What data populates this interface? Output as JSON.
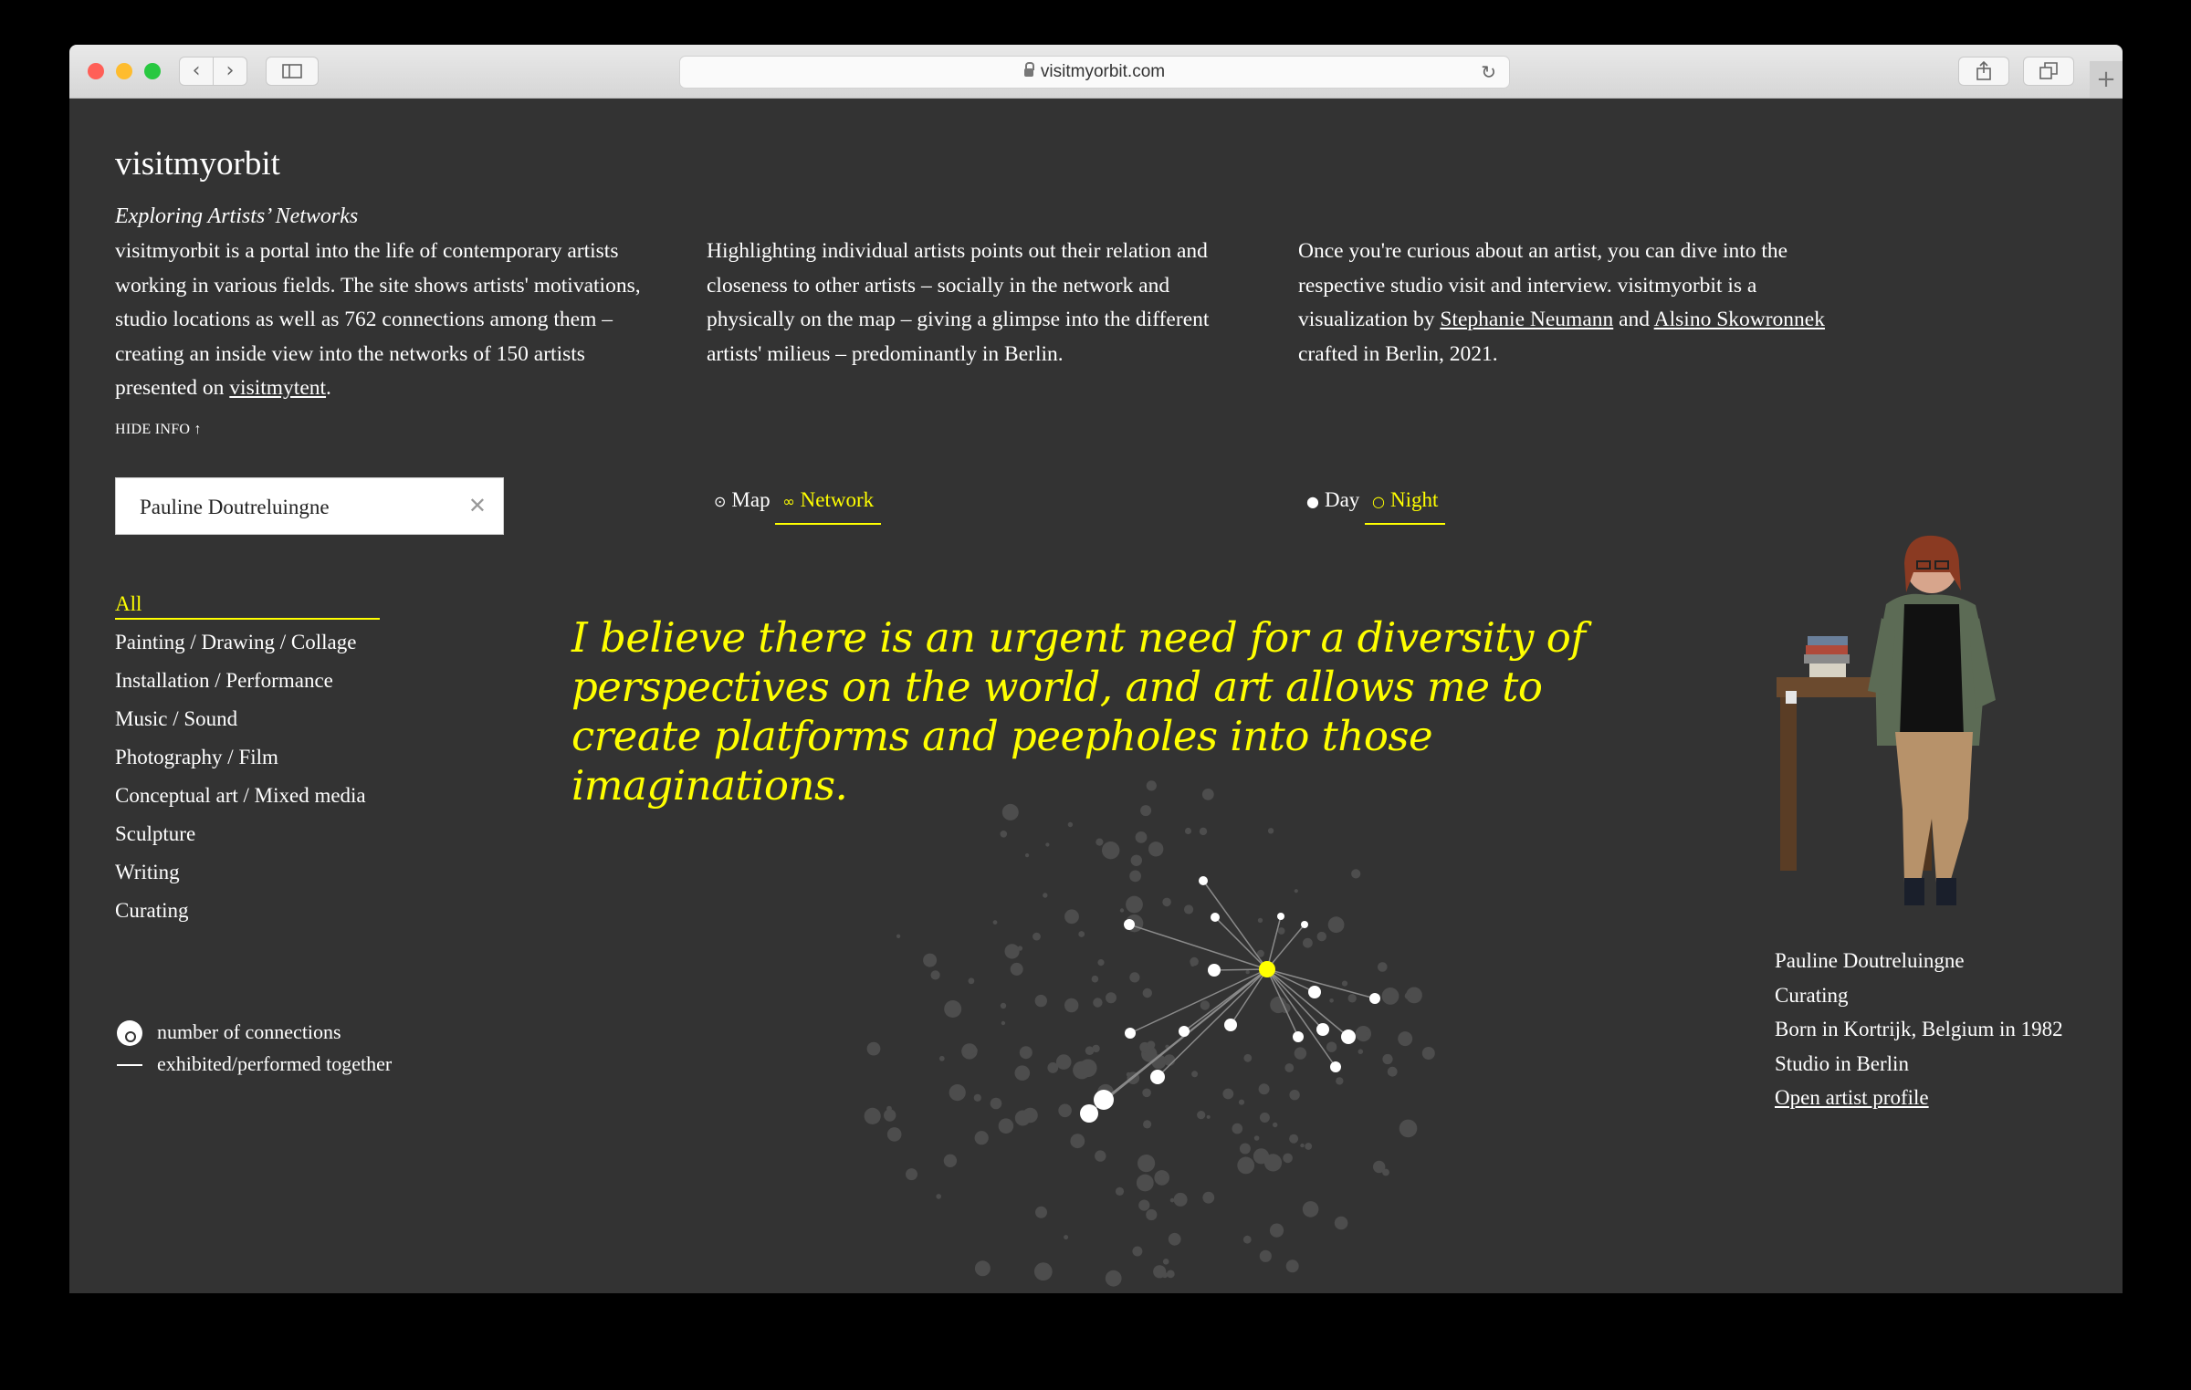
{
  "browser": {
    "url": "visitmyorbit.com",
    "back_icon": "‹",
    "forward_icon": "›",
    "plus_label": "+"
  },
  "site": {
    "title": "visitmyorbit",
    "tagline": "Exploring Artists’ Networks",
    "intro_1_pre": "visitmyorbit is a portal into the life of contemporary artists working in various fields. The site shows artists' motivations, studio locations as well as 762 connections among them – creating an inside view into the networks of 150 artists presented on ",
    "intro_1_link": "visitmytent",
    "intro_1_post": ".",
    "intro_2": "Highlighting individual artists points out their relation and closeness to other artists – socially in the network and physically on the map – giving a glimpse into the different artists' milieus – predominantly in Berlin.",
    "intro_3_pre": "Once you're curious about an artist, you can dive into the respective studio visit and interview. visitmyorbit is a visualization by ",
    "intro_3_link1": "Stephanie Neumann",
    "intro_3_mid": " and ",
    "intro_3_link2": "Alsino Skowronnek",
    "intro_3_post": " crafted in Berlin, 2021.",
    "hide_info": "HIDE INFO ↑"
  },
  "search": {
    "value": "Pauline Doutreluingne",
    "clear_icon": "✕"
  },
  "view_toggle": {
    "map": "Map",
    "network": "Network",
    "active": "network"
  },
  "mode_toggle": {
    "day": "Day",
    "night": "Night",
    "active": "night"
  },
  "categories": [
    {
      "label": "All",
      "active": true
    },
    {
      "label": "Painting / Drawing / Collage",
      "active": false
    },
    {
      "label": "Installation / Performance",
      "active": false
    },
    {
      "label": "Music / Sound",
      "active": false
    },
    {
      "label": "Photography / Film",
      "active": false
    },
    {
      "label": "Conceptual art / Mixed media",
      "active": false
    },
    {
      "label": "Sculpture",
      "active": false
    },
    {
      "label": "Writing",
      "active": false
    },
    {
      "label": "Curating",
      "active": false
    }
  ],
  "legend": {
    "connections": "number of connections",
    "together": "exhibited/performed together"
  },
  "quote": "I believe there is an urgent need for a diversity of perspectives on the world, and art allows me to create platforms and peepholes into those imaginations.",
  "artist": {
    "name": "Pauline Doutreluingne",
    "discipline": "Curating",
    "born": "Born in Kortrijk, Belgium in 1982",
    "studio": "Studio in Berlin",
    "profile_link": "Open artist profile"
  },
  "colors": {
    "accent": "#ffff00",
    "background": "#333333",
    "node_dim": "#555555",
    "node_connected": "#ffffff"
  }
}
